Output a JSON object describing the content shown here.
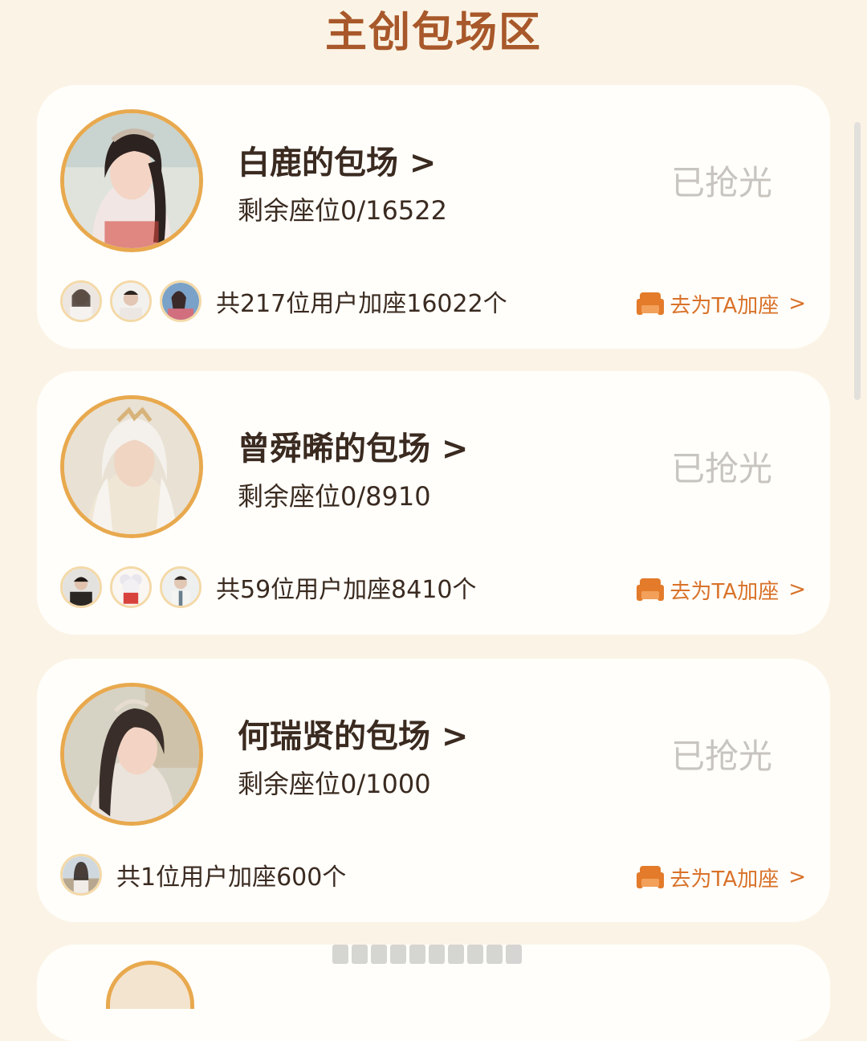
{
  "page": {
    "title": "主创包场区"
  },
  "theme": {
    "background": "#fbf4e6",
    "title_color": "#a8582a",
    "accent": "#d9722a",
    "avatar_ring": "#e8a94e",
    "sold_out_color": "#c8c4bf"
  },
  "cards": [
    {
      "name": "白鹿的包场 >",
      "seats": "剩余座位0/16522",
      "status": "已抢光",
      "supporters": "共217位用户加座16022个",
      "action": "去为TA加座",
      "action_chevron": ">",
      "avatar_icon": "actress-portrait",
      "mini_avatars": [
        "user-avatar",
        "user-avatar",
        "user-avatar"
      ]
    },
    {
      "name": "曾舜晞的包场 >",
      "seats": "剩余座位0/8910",
      "status": "已抢光",
      "supporters": "共59位用户加座8410个",
      "action": "去为TA加座",
      "action_chevron": ">",
      "avatar_icon": "actor-portrait",
      "mini_avatars": [
        "user-avatar",
        "user-avatar",
        "user-avatar"
      ]
    },
    {
      "name": "何瑞贤的包场 >",
      "seats": "剩余座位0/1000",
      "status": "已抢光",
      "supporters": "共1位用户加座600个",
      "action": "去为TA加座",
      "action_chevron": ">",
      "avatar_icon": "actress-portrait",
      "mini_avatars": [
        "user-avatar"
      ]
    }
  ]
}
